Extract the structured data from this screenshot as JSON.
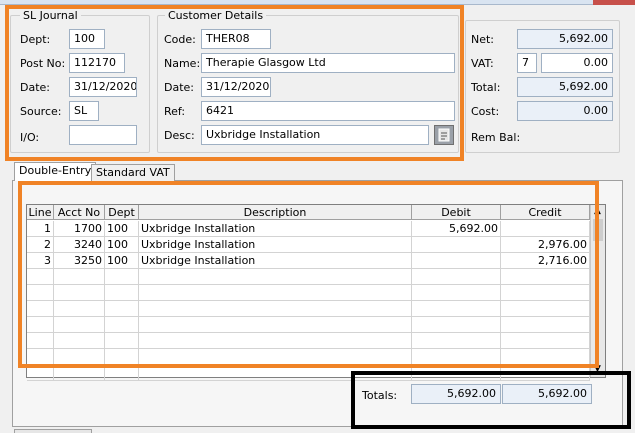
{
  "sl_journal": {
    "title": "SL Journal",
    "dept_label": "Dept:",
    "dept": "100",
    "postno_label": "Post No:",
    "postno": "112170",
    "date_label": "Date:",
    "date": "31/12/2020",
    "source_label": "Source:",
    "source": "SL",
    "io_label": "I/O:",
    "io": ""
  },
  "customer": {
    "title": "Customer Details",
    "code_label": "Code:",
    "code": "THER08",
    "name_label": "Name:",
    "name": "Therapie Glasgow Ltd",
    "date_label": "Date:",
    "date": "31/12/2020",
    "ref_label": "Ref:",
    "ref": "6421",
    "desc_label": "Desc:",
    "desc": "Uxbridge Installation"
  },
  "totals_panel": {
    "net_label": "Net:",
    "net": "5,692.00",
    "vat_label": "VAT:",
    "vat_code": "7",
    "vat": "0.00",
    "total_label": "Total:",
    "total": "5,692.00",
    "cost_label": "Cost:",
    "cost": "0.00",
    "rembal_label": "Rem Bal:"
  },
  "tabs": [
    {
      "label": "Double-Entry",
      "active": true
    },
    {
      "label": "Standard VAT",
      "active": false
    }
  ],
  "grid": {
    "headers": [
      "Line",
      "Acct No",
      "Dept",
      "Description",
      "Debit",
      "Credit"
    ],
    "rows": [
      {
        "line": "1",
        "acct": "1700",
        "dept": "100",
        "desc": "Uxbridge Installation",
        "debit": "5,692.00",
        "credit": ""
      },
      {
        "line": "2",
        "acct": "3240",
        "dept": "100",
        "desc": "Uxbridge Installation",
        "debit": "",
        "credit": "2,976.00"
      },
      {
        "line": "3",
        "acct": "3250",
        "dept": "100",
        "desc": "Uxbridge Installation",
        "debit": "",
        "credit": "2,716.00"
      }
    ],
    "empty_rows": 7
  },
  "grid_totals": {
    "label": "Totals:",
    "debit": "5,692.00",
    "credit": "5,692.00"
  },
  "colors": {
    "highlight_orange": "#f08326",
    "highlight_black": "#000000",
    "readonly_field": "#eaf0f8"
  }
}
